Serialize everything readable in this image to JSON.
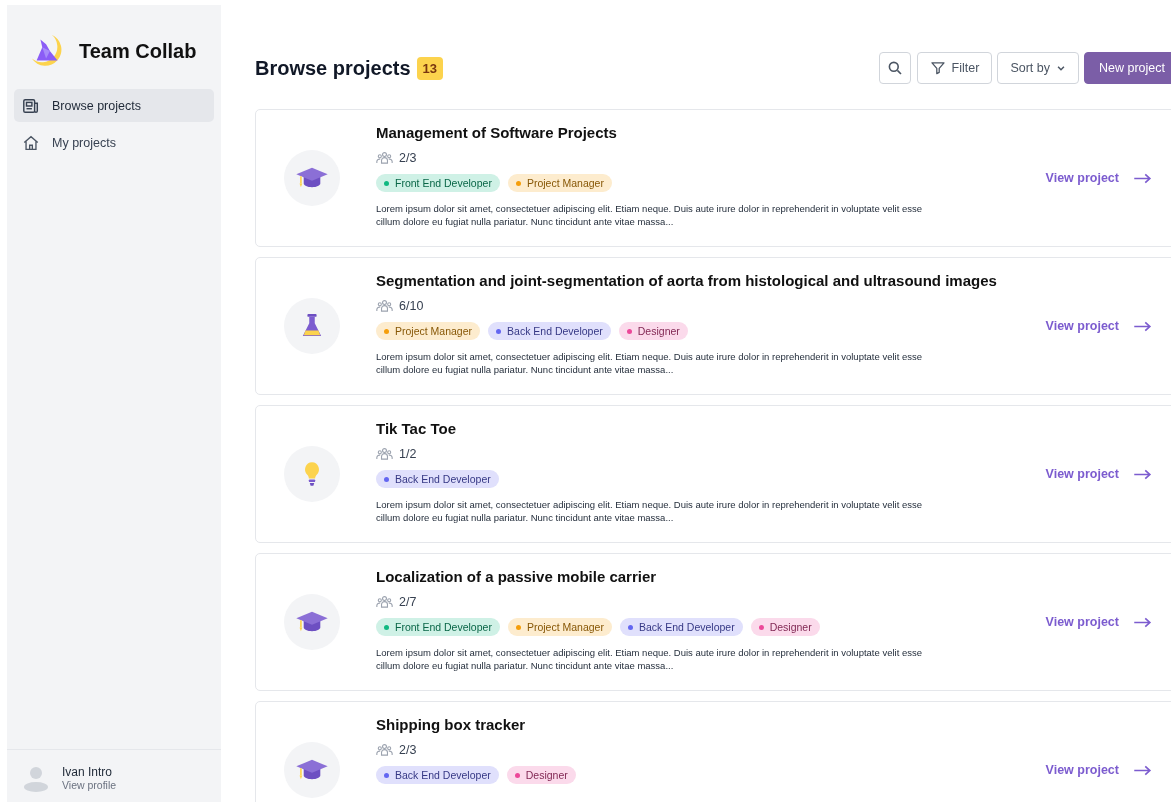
{
  "sidebar": {
    "app_name": "Team Collab",
    "nav": [
      {
        "label": "Browse projects",
        "kind": "browse",
        "selected": true
      },
      {
        "label": "My projects",
        "kind": "home",
        "selected": false
      }
    ],
    "user": {
      "name": "Ivan Intro",
      "link": "View profile"
    }
  },
  "header": {
    "title": "Browse projects",
    "count": "13",
    "filter": "Filter",
    "sort": "Sort by",
    "new_project": "New project"
  },
  "projects": [
    {
      "kind": "cap",
      "title": "Management of Software Projects",
      "members": "2/3",
      "tags": [
        {
          "label": "Front End Developer",
          "color": "#10b981"
        },
        {
          "label": "Project Manager",
          "color": "#f59e0b"
        }
      ],
      "description": "Lorem ipsum dolor sit amet, consectetuer adipiscing elit. Etiam neque. Duis aute irure dolor in reprehenderit in voluptate velit esse cillum dolore eu fugiat nulla pariatur. Nunc tincidunt ante vitae massa...",
      "link": "View project"
    },
    {
      "kind": "flask",
      "title": "Segmentation and joint-segmentation of aorta from histological and ultrasound images",
      "members": "6/10",
      "tags": [
        {
          "label": "Project Manager",
          "color": "#f59e0b"
        },
        {
          "label": "Back End Developer",
          "color": "#6366f1"
        },
        {
          "label": "Designer",
          "color": "#ec4899"
        }
      ],
      "description": "Lorem ipsum dolor sit amet, consectetuer adipiscing elit. Etiam neque. Duis aute irure dolor in reprehenderit in voluptate velit esse cillum dolore eu fugiat nulla pariatur. Nunc tincidunt ante vitae massa...",
      "link": "View project"
    },
    {
      "kind": "bulb",
      "title": "Tik Tac Toe",
      "members": "1/2",
      "tags": [
        {
          "label": "Back End Developer",
          "color": "#6366f1"
        }
      ],
      "description": "Lorem ipsum dolor sit amet, consectetuer adipiscing elit. Etiam neque. Duis aute irure dolor in reprehenderit in voluptate velit esse cillum dolore eu fugiat nulla pariatur. Nunc tincidunt ante vitae massa...",
      "link": "View project"
    },
    {
      "kind": "cap",
      "title": "Localization of a passive mobile carrier",
      "members": "2/7",
      "tags": [
        {
          "label": "Front End Developer",
          "color": "#10b981"
        },
        {
          "label": "Project Manager",
          "color": "#f59e0b"
        },
        {
          "label": "Back End Developer",
          "color": "#6366f1"
        },
        {
          "label": "Designer",
          "color": "#ec4899"
        }
      ],
      "description": "Lorem ipsum dolor sit amet, consectetuer adipiscing elit. Etiam neque. Duis aute irure dolor in reprehenderit in voluptate velit esse cillum dolore eu fugiat nulla pariatur. Nunc tincidunt ante vitae massa...",
      "link": "View project"
    },
    {
      "kind": "cap",
      "title": "Shipping box tracker",
      "members": "2/3",
      "tags": [
        {
          "label": "Back End Developer",
          "color": "#6366f1"
        },
        {
          "label": "Designer",
          "color": "#ec4899"
        }
      ],
      "link": "View project"
    }
  ]
}
